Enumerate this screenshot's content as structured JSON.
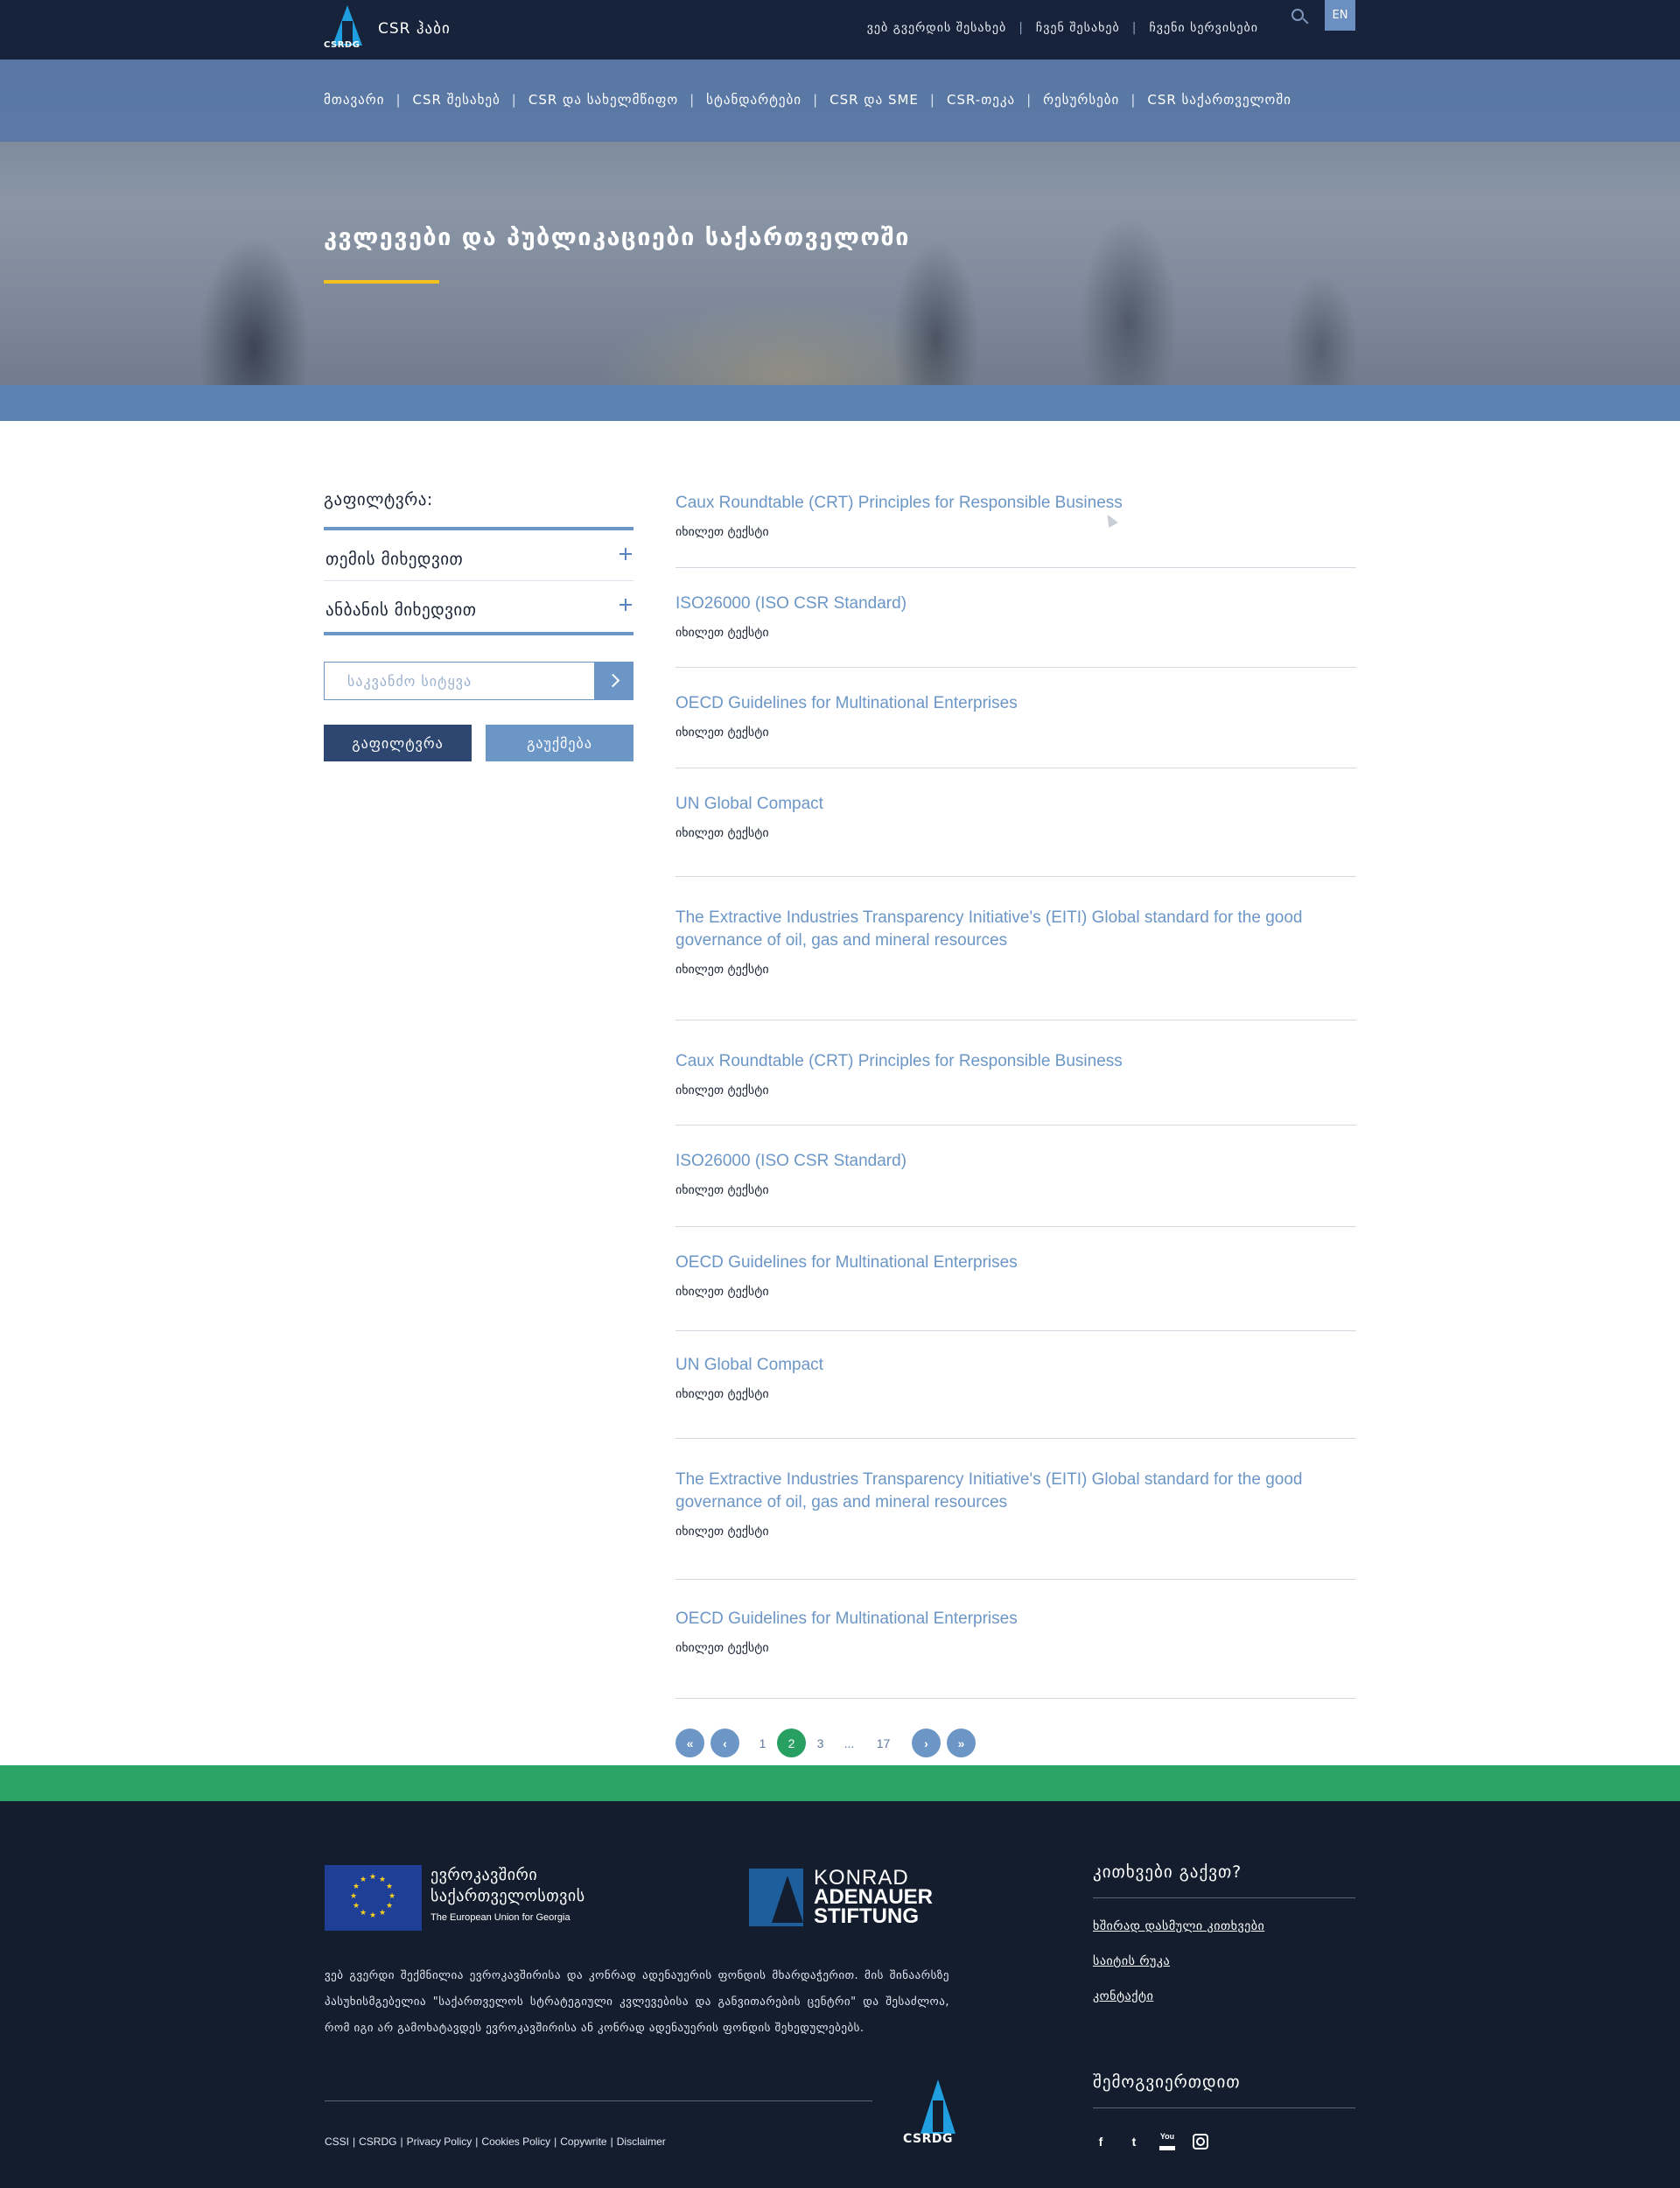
{
  "header": {
    "brand_code": "CSRDG",
    "brand_name": "CSR ჰაბი",
    "top_links": [
      "ვებ გვერდის შესახებ",
      "ჩვენ შესახებ",
      "ჩვენი სერვისები"
    ],
    "language": "EN",
    "search_icon": "search-icon"
  },
  "main_nav": [
    "მთავარი",
    "CSR შესახებ",
    "CSR და სახელმწიფო",
    "სტანდარტები",
    "CSR და SME",
    "CSR-თეკა",
    "რესურსები",
    "CSR საქართველოში"
  ],
  "hero": {
    "title": "კვლევები და პუბლიკაციები საქართველოში",
    "accent_color": "#f2c01f"
  },
  "sidebar": {
    "filter_label": "გაფილტვრა:",
    "accordion": [
      {
        "label": "თემის მიხედვით",
        "icon": "plus-icon"
      },
      {
        "label": "ანბანის მიხედვით",
        "icon": "plus-icon"
      }
    ],
    "search_placeholder": "საკვანძო სიტყვა",
    "filter_button": "გაფილტვრა",
    "cancel_button": "გაუქმება"
  },
  "list": {
    "items": [
      {
        "title": "Caux Roundtable (CRT) Principles for Responsible Business",
        "link": "იხილეთ ტექსტი"
      },
      {
        "title": "ISO26000 (ISO CSR Standard)",
        "link": "იხილეთ ტექსტი"
      },
      {
        "title": "OECD Guidelines for Multinational Enterprises",
        "link": "იხილეთ ტექსტი"
      },
      {
        "title": "UN Global Compact",
        "link": "იხილეთ ტექსტი"
      },
      {
        "title": "The Extractive Industries Transparency Initiative's (EITI) Global standard for the good governance of oil, gas and mineral resources",
        "link": "იხილეთ ტექსტი"
      },
      {
        "title": "Caux Roundtable (CRT) Principles for Responsible Business",
        "link": "იხილეთ ტექსტი"
      },
      {
        "title": "ISO26000 (ISO CSR Standard)",
        "link": "იხილეთ ტექსტი"
      },
      {
        "title": "OECD Guidelines for Multinational Enterprises",
        "link": "იხილეთ ტექსტი"
      },
      {
        "title": "UN Global Compact",
        "link": "იხილეთ ტექსტი"
      },
      {
        "title": "The Extractive Industries Transparency Initiative's (EITI) Global standard for the good governance of oil, gas and mineral resources",
        "link": "იხილეთ ტექსტი"
      },
      {
        "title": "OECD Guidelines for Multinational Enterprises",
        "link": "იხილეთ ტექსტი"
      }
    ]
  },
  "pagination": {
    "first": "«",
    "prev": "‹",
    "pages": [
      "1",
      "2",
      "3",
      "...",
      "17"
    ],
    "current": "2",
    "next": "›",
    "last": "»"
  },
  "footer": {
    "eu_line1": "ევროკავშირი",
    "eu_line2": "საქართველოსთვის",
    "eu_line3": "The European Union for Georgia",
    "kas_line1": "KONRAD",
    "kas_line2": "ADENAUER",
    "kas_line3": "STIFTUNG",
    "disclaimer": "ვებ გვერდი შექმნილია ევროკავშირისა და კონრად ადენაუერის ფონდის მხარდაჭერით. მის შინაარსზე პასუხისმგებელია \"საქართველოს სტრატეგიული კვლევებისა და განვითარების ცენტრი\" და შესაძლოა, რომ იგი არ გამოხატავდეს ევროკავშირისა ან კონრად ადენაუერის ფონდის შეხედულებებს.",
    "bottom_links": [
      "CSSI",
      "CSRDG",
      "Privacy Policy",
      "Cookies Policy",
      "Copywrite",
      "Disclaimer"
    ],
    "logo_code": "CSRDG",
    "questions_title": "კითხვები გაქვთ?",
    "question_links": [
      "ხშირად დასმული კითხვები",
      "საიტის რუკა",
      "კონტაქტი"
    ],
    "follow_title": "შემოგვიერთდით",
    "social_icons": [
      "facebook-icon",
      "twitter-icon",
      "youtube-icon",
      "instagram-icon"
    ],
    "green_bar_color": "#2ba564"
  }
}
